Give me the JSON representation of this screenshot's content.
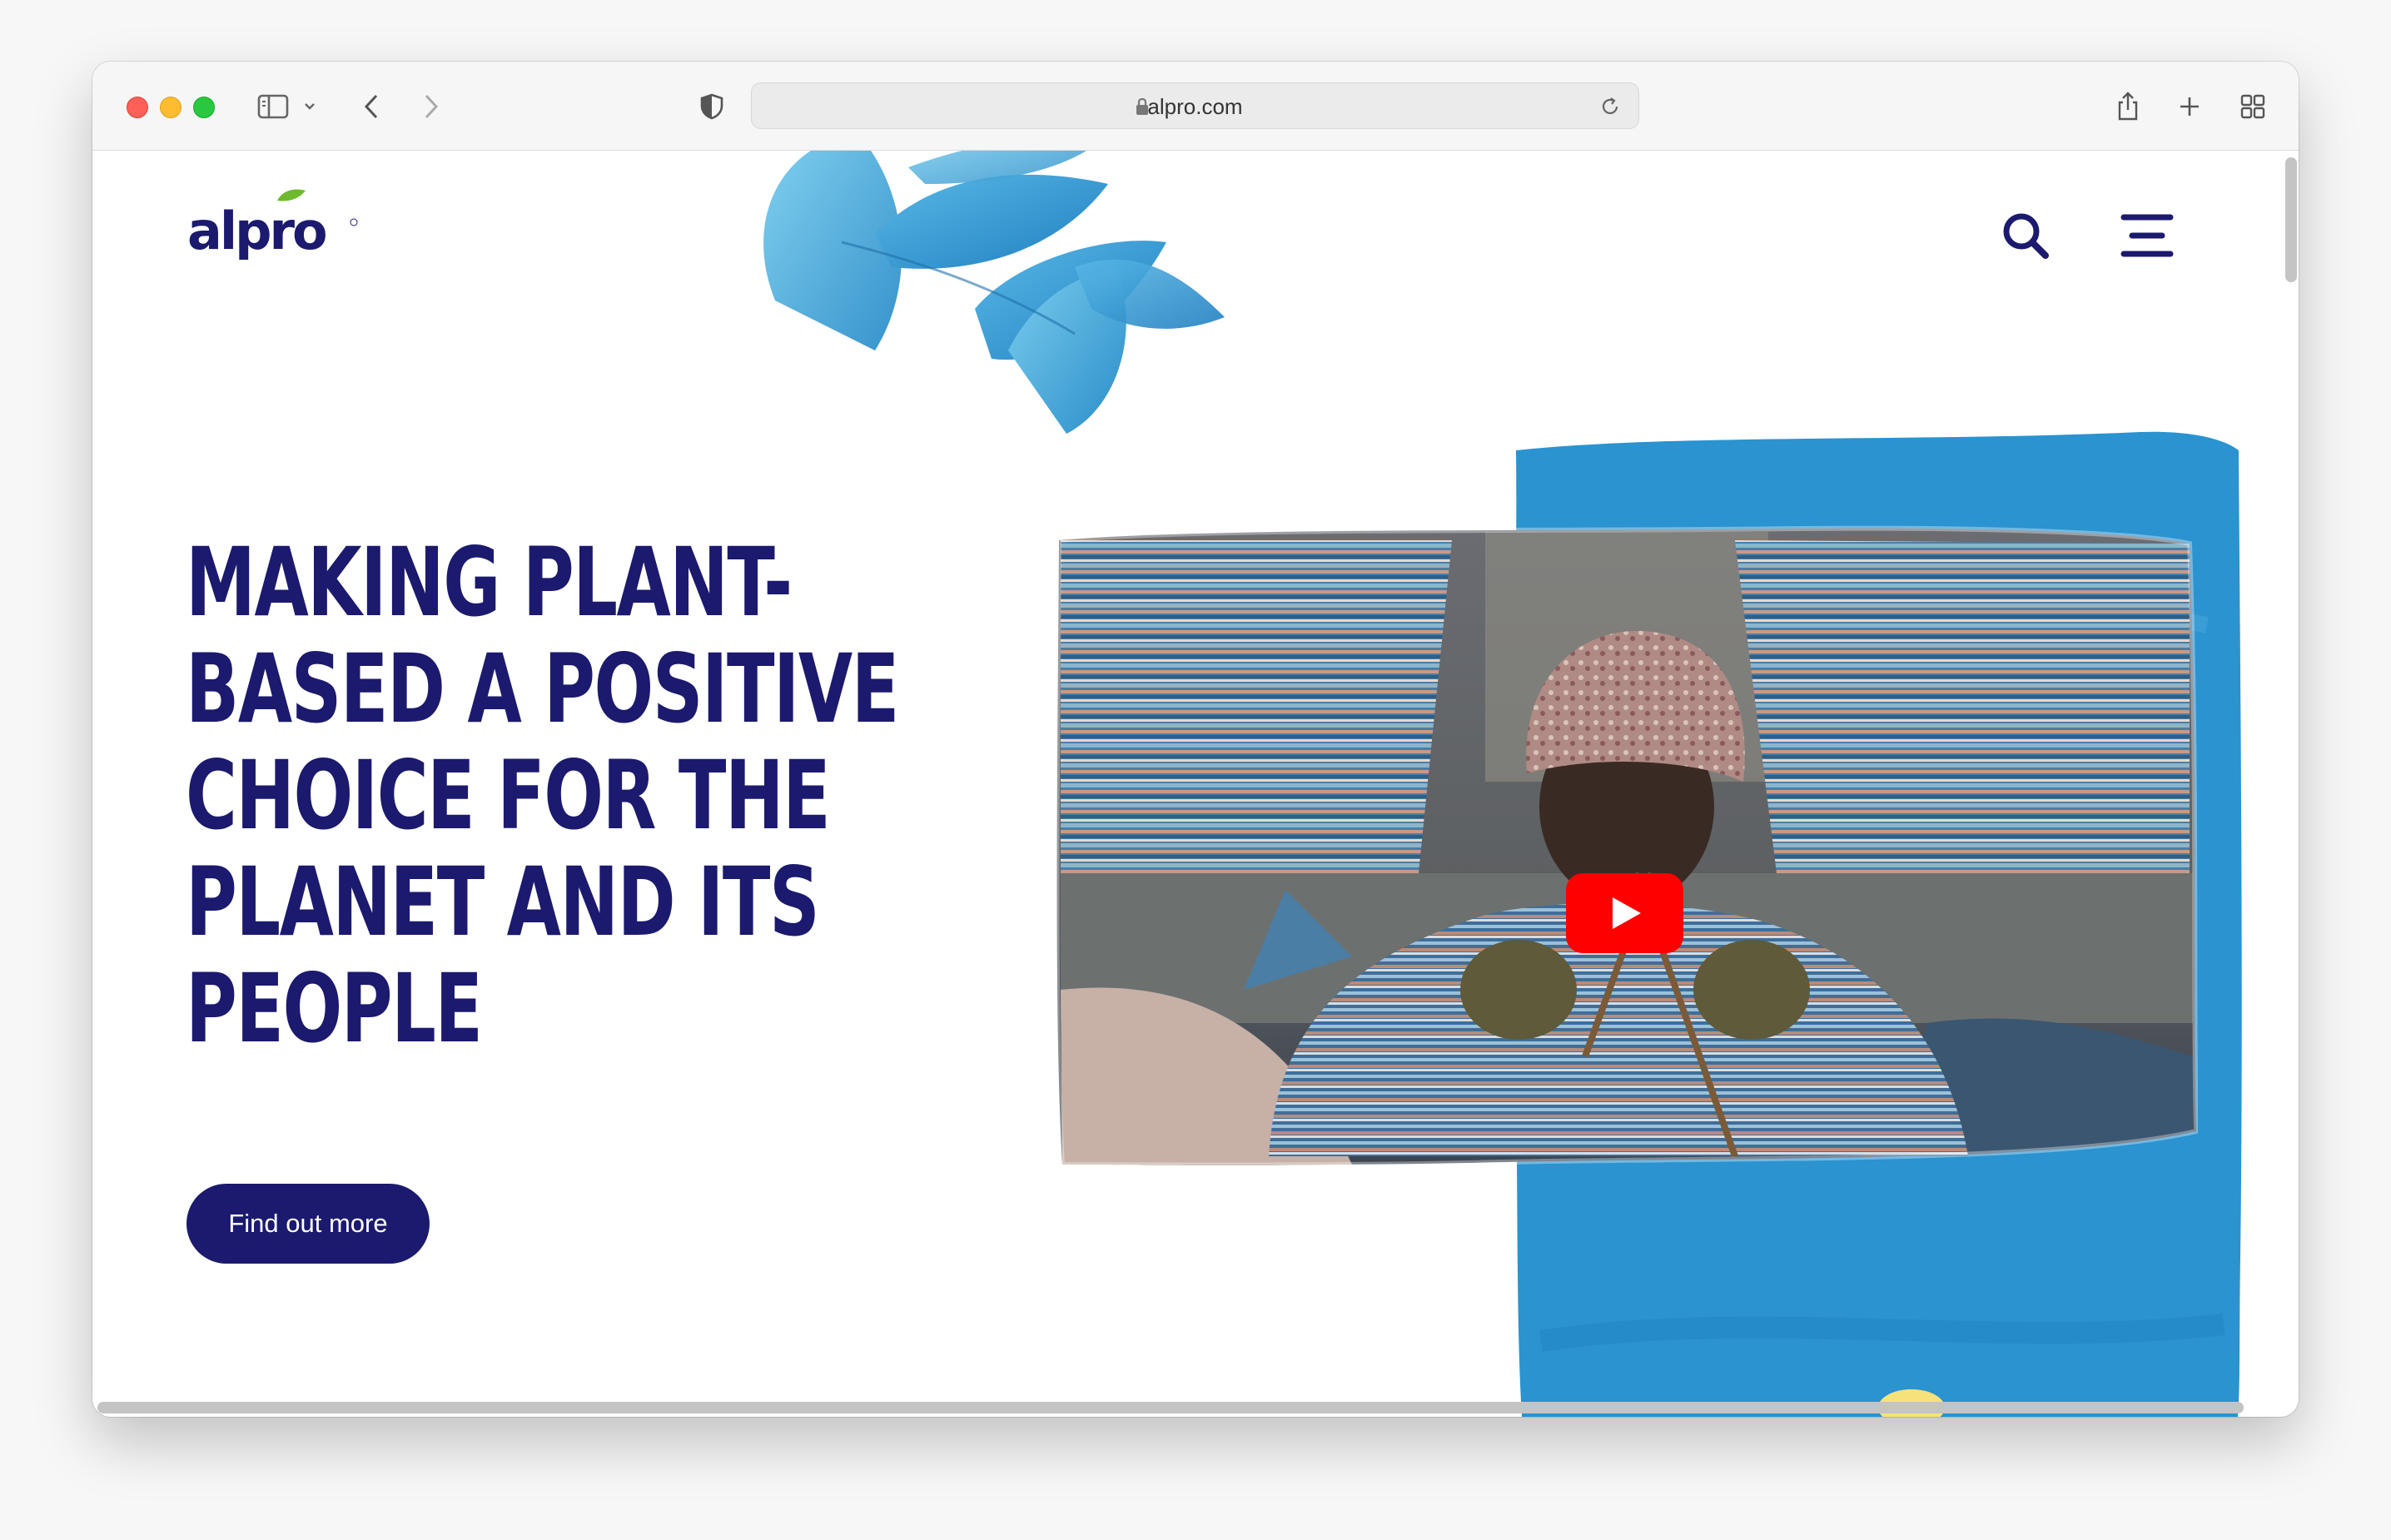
{
  "browser": {
    "url": "alpro.com",
    "icons": [
      "sidebar-icon",
      "chevron-down-icon",
      "back-icon",
      "forward-icon",
      "shield-icon",
      "lock-icon",
      "reload-icon",
      "share-icon",
      "new-tab-icon",
      "tab-overview-icon"
    ]
  },
  "site": {
    "logo_text": "alpro",
    "headline": "MAKING PLANT-BASED A POSITIVE CHOICE FOR THE PLANET AND ITS PEOPLE",
    "cta_label": "Find out more",
    "nav_icons": [
      "search-icon",
      "menu-icon"
    ],
    "video": {
      "has_play_button": true
    }
  },
  "colors": {
    "brand_navy": "#1b1a6e",
    "brand_blue": "#2a93d0",
    "play_red": "#ff0000"
  }
}
